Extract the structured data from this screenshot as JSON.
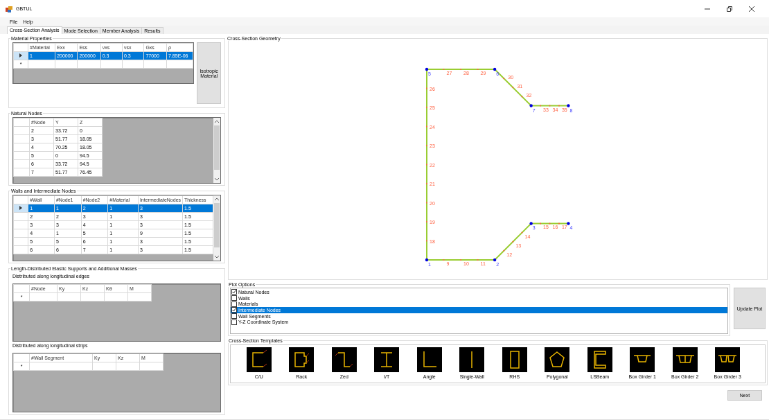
{
  "window": {
    "title": "GBTUL"
  },
  "menu": [
    "File",
    "Help"
  ],
  "tabs": [
    {
      "label": "Cross-Section Analysis",
      "selected": true
    },
    {
      "label": "Mode Selection",
      "selected": false
    },
    {
      "label": "Member Analysis",
      "selected": false
    },
    {
      "label": "Results",
      "selected": false
    }
  ],
  "material_properties": {
    "title": "Material Properties",
    "button": "Isotropic Material",
    "grid": {
      "columns": [
        "#Material",
        "Exx",
        "Ess",
        "νxs",
        "νsx",
        "Gxs",
        "ρ"
      ],
      "rows": [
        {
          "cells": [
            "1",
            "200000",
            "200000",
            "0.3",
            "0.3",
            "77000",
            "7.85E-06"
          ],
          "selected": true
        }
      ],
      "new_row_mark": "*"
    }
  },
  "natural_nodes": {
    "title": "Natural Nodes",
    "grid": {
      "columns": [
        "#Node",
        "Y",
        "Z"
      ],
      "rows": [
        {
          "cells": [
            "2",
            "33.72",
            "0"
          ],
          "selected": false
        },
        {
          "cells": [
            "3",
            "51.77",
            "18.05"
          ],
          "selected": false
        },
        {
          "cells": [
            "4",
            "70.25",
            "18.05"
          ],
          "selected": false
        },
        {
          "cells": [
            "5",
            "0",
            "94.5"
          ],
          "selected": false
        },
        {
          "cells": [
            "6",
            "33.72",
            "94.5"
          ],
          "selected": false
        },
        {
          "cells": [
            "7",
            "51.77",
            "76.45"
          ],
          "selected": false
        }
      ]
    }
  },
  "walls": {
    "title": "Walls and Intermediate Nodes",
    "grid": {
      "columns": [
        "#Wall",
        "#Node1",
        "#Node2",
        "#Material",
        "IntermediateNodes",
        "Thickness"
      ],
      "rows": [
        {
          "cells": [
            "1",
            "1",
            "2",
            "1",
            "3",
            "1.5"
          ],
          "selected": true
        },
        {
          "cells": [
            "2",
            "2",
            "3",
            "1",
            "3",
            "1.5"
          ],
          "selected": false
        },
        {
          "cells": [
            "3",
            "3",
            "4",
            "1",
            "3",
            "1.5"
          ],
          "selected": false
        },
        {
          "cells": [
            "4",
            "1",
            "5",
            "1",
            "9",
            "1.5"
          ],
          "selected": false
        },
        {
          "cells": [
            "5",
            "5",
            "6",
            "1",
            "3",
            "1.5"
          ],
          "selected": false
        },
        {
          "cells": [
            "6",
            "6",
            "7",
            "1",
            "3",
            "1.5"
          ],
          "selected": false
        }
      ]
    }
  },
  "supports": {
    "title": "Length-Distributed Elastic Supports and Additional Masses",
    "edges": {
      "title": "Distributed along longitudinal edges",
      "grid": {
        "columns": [
          "#Node",
          "Ky",
          "Kz",
          "Kθ",
          "M"
        ],
        "new_row_mark": "*"
      }
    },
    "strips": {
      "title": "Distributed along longitudinal strips",
      "grid": {
        "columns": [
          "#Wall Segment",
          "Ky",
          "Kz",
          "M"
        ],
        "new_row_mark": "*"
      }
    }
  },
  "geometry": {
    "title": "Cross-Section Geometry",
    "natural_nodes": [
      "1",
      "2",
      "3",
      "4",
      "5",
      "6",
      "7",
      "8"
    ],
    "walls": [
      {
        "intermediate_nodes": [
          "9",
          "10",
          "11"
        ]
      },
      {
        "intermediate_nodes": [
          "12",
          "13",
          "14"
        ]
      },
      {
        "intermediate_nodes": [
          "15",
          "16",
          "17"
        ]
      },
      {
        "intermediate_nodes": [
          "26",
          "25",
          "24",
          "23",
          "22",
          "21",
          "20",
          "19",
          "18"
        ]
      },
      {
        "intermediate_nodes": [
          "27",
          "28",
          "29"
        ]
      },
      {
        "intermediate_nodes": [
          "30",
          "31",
          "32"
        ]
      },
      {
        "intermediate_nodes": [
          "33",
          "34",
          "35"
        ]
      }
    ]
  },
  "plot_options": {
    "title": "Plot Options",
    "button": "Update Plot",
    "items": [
      {
        "label": "Natural Nodes",
        "checked": true,
        "selected": false
      },
      {
        "label": "Walls",
        "checked": false,
        "selected": false
      },
      {
        "label": "Materials",
        "checked": false,
        "selected": false
      },
      {
        "label": "Intermediate Nodes",
        "checked": true,
        "selected": true
      },
      {
        "label": "Wall Segments",
        "checked": false,
        "selected": false
      },
      {
        "label": "Y-Z Coordinate System",
        "checked": false,
        "selected": false
      }
    ]
  },
  "templates": {
    "title": "Cross-Section Templates",
    "items": [
      {
        "label": "C/U",
        "kind": "channel"
      },
      {
        "label": "Rack",
        "kind": "rack"
      },
      {
        "label": "Zed",
        "kind": "zed"
      },
      {
        "label": "I/T",
        "kind": "ibeam"
      },
      {
        "label": "Angle",
        "kind": "angle"
      },
      {
        "label": "Single-Wall",
        "kind": "single"
      },
      {
        "label": "RHS",
        "kind": "rhs"
      },
      {
        "label": "Polygonal",
        "kind": "polygon"
      },
      {
        "label": "LSBeam",
        "kind": "lsbeam"
      },
      {
        "label": "Box Girder 1",
        "kind": "box1"
      },
      {
        "label": "Box Girder 2",
        "kind": "box2"
      },
      {
        "label": "Box Girder 3",
        "kind": "box3"
      }
    ]
  },
  "next_button": "Next"
}
